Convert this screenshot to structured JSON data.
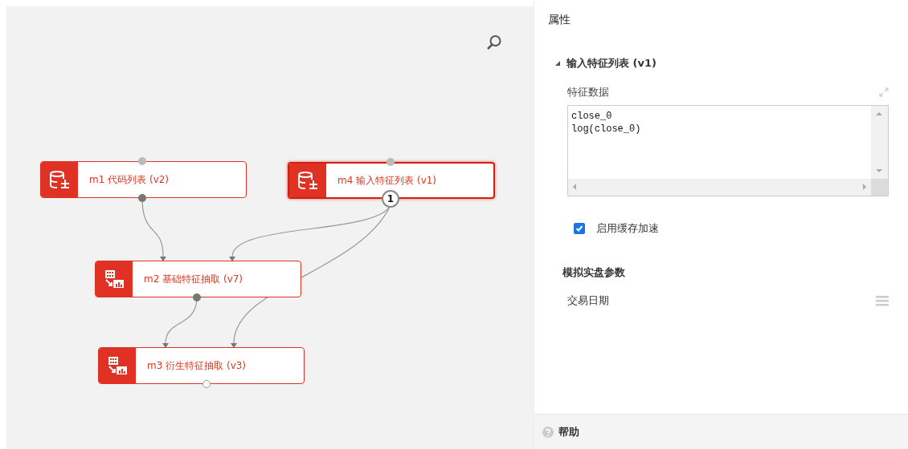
{
  "canvas": {
    "nodes": [
      {
        "label": "m1 代码列表 (v2)",
        "kind": "source",
        "selected": false
      },
      {
        "label": "m4 输入特征列表 (v1)",
        "kind": "source",
        "selected": true,
        "output_badge": "1"
      },
      {
        "label": "m2 基础特征抽取 (v7)",
        "kind": "transform",
        "selected": false
      },
      {
        "label": "m3 衍生特征抽取 (v3)",
        "kind": "transform",
        "selected": false
      }
    ]
  },
  "properties": {
    "title": "属性",
    "section": {
      "title": "输入特征列表 (v1)",
      "expanded": true
    },
    "field_label": "特征数据",
    "field_lines": [
      "close_0",
      "log(close_0)"
    ],
    "cache": {
      "label": "启用缓存加速",
      "checked": true
    },
    "group_title": "模拟实盘参数",
    "param_label": "交易日期"
  },
  "help": "帮助"
}
